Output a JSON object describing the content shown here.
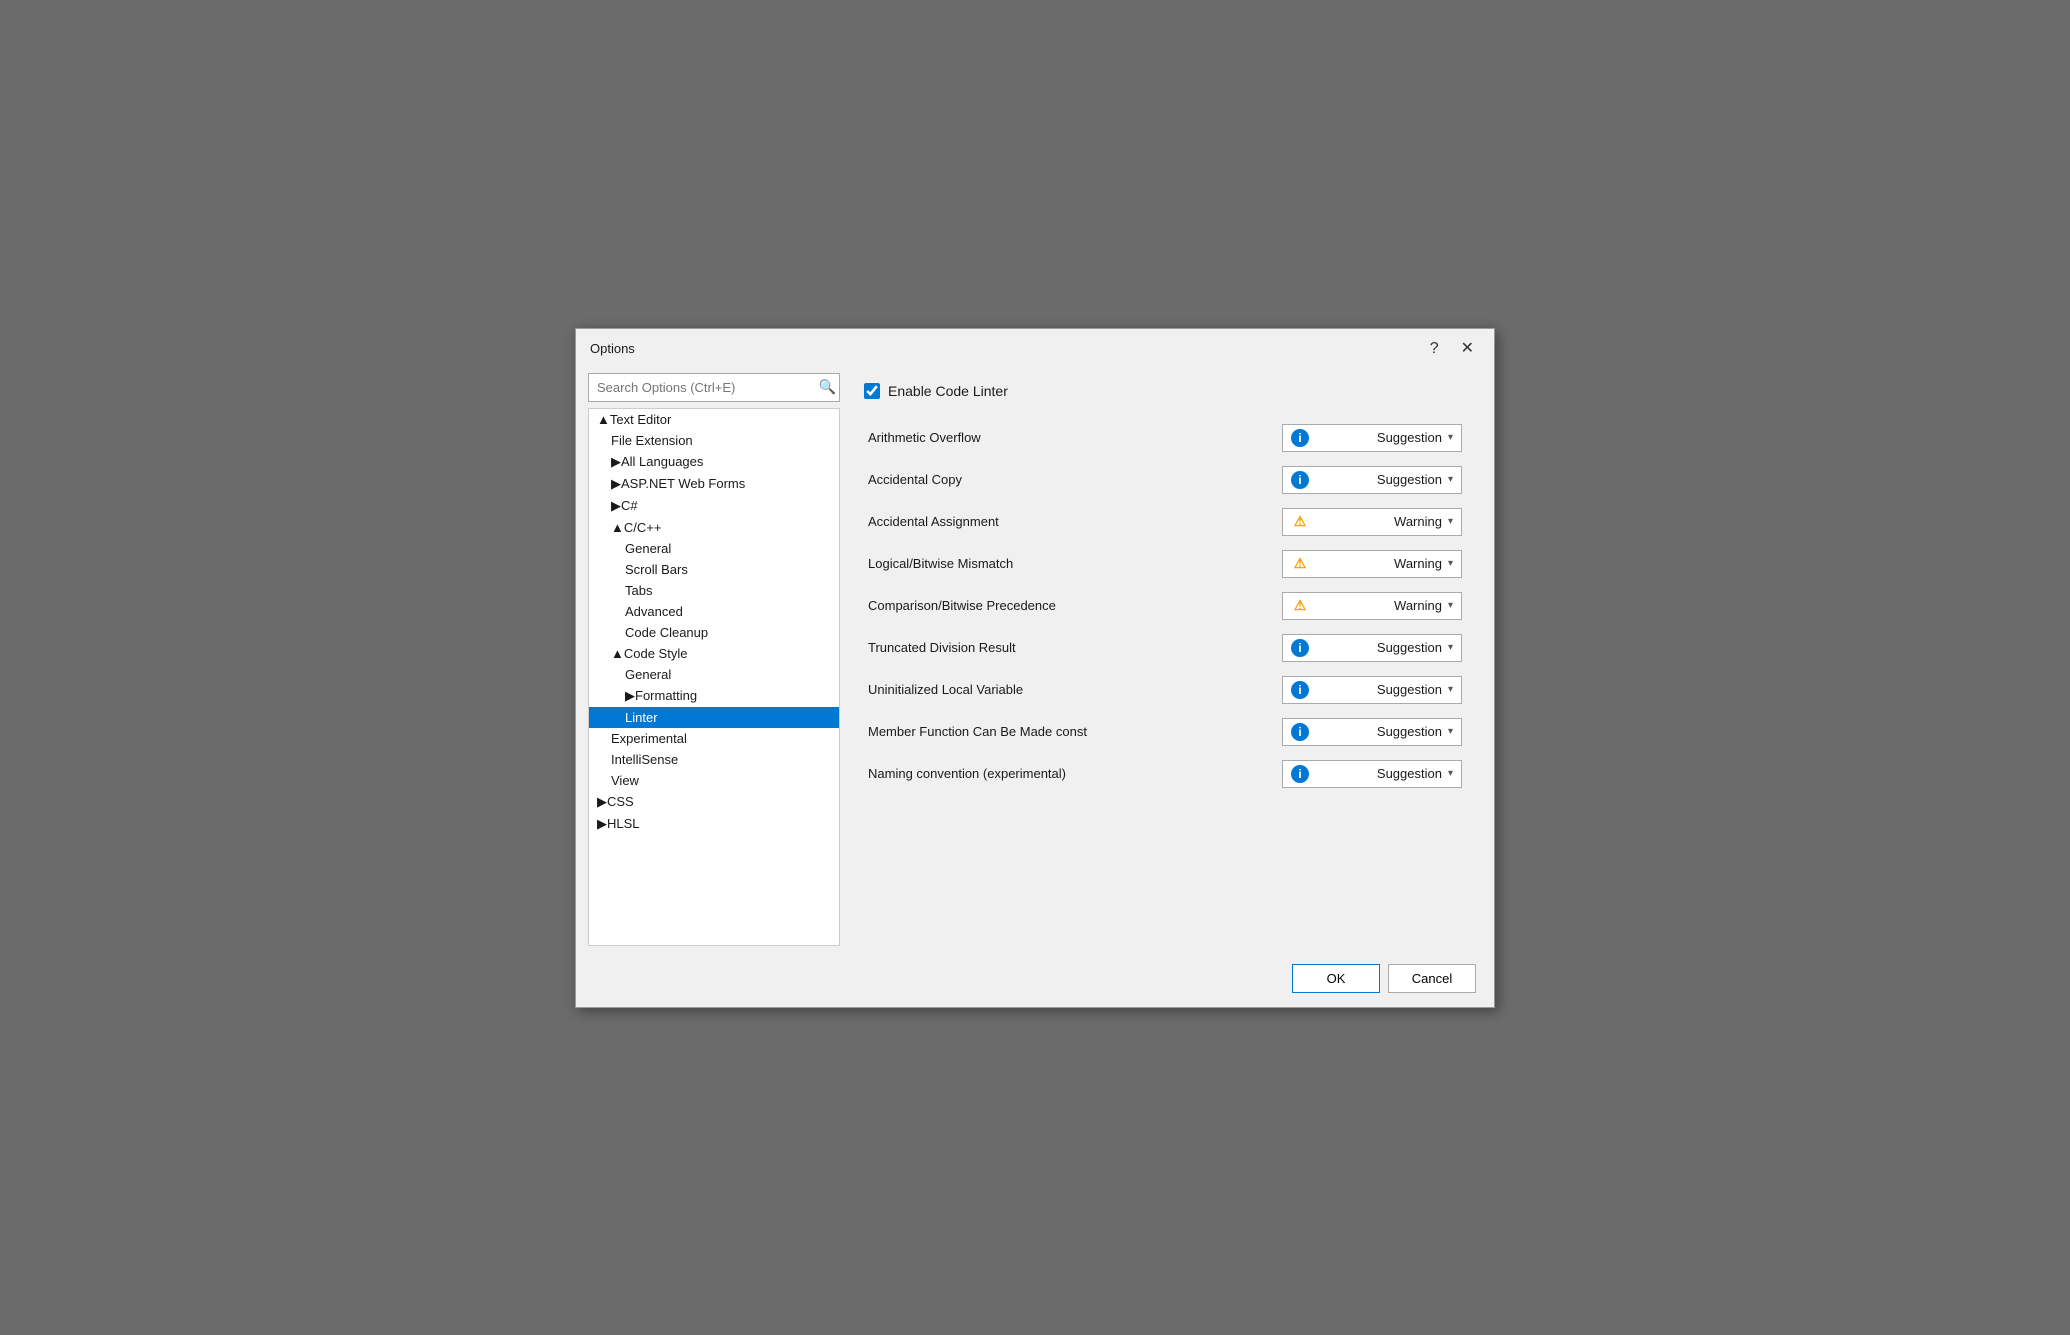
{
  "dialog": {
    "title": "Options",
    "help_btn": "?",
    "close_btn": "✕"
  },
  "search": {
    "placeholder": "Search Options (Ctrl+E)",
    "icon": "🔍"
  },
  "tree": {
    "items": [
      {
        "id": "text-editor",
        "label": "▲Text Editor",
        "level": 0,
        "selected": false
      },
      {
        "id": "file-extension",
        "label": "File Extension",
        "level": 1,
        "selected": false
      },
      {
        "id": "all-languages",
        "label": "▶All Languages",
        "level": 1,
        "selected": false
      },
      {
        "id": "aspnet",
        "label": "▶ASP.NET Web Forms",
        "level": 1,
        "selected": false
      },
      {
        "id": "csharp",
        "label": "▶C#",
        "level": 1,
        "selected": false
      },
      {
        "id": "cpp",
        "label": "▲C/C++",
        "level": 1,
        "selected": false
      },
      {
        "id": "cpp-general",
        "label": "General",
        "level": 2,
        "selected": false
      },
      {
        "id": "cpp-scrollbars",
        "label": "Scroll Bars",
        "level": 2,
        "selected": false
      },
      {
        "id": "cpp-tabs",
        "label": "Tabs",
        "level": 2,
        "selected": false
      },
      {
        "id": "cpp-advanced",
        "label": "Advanced",
        "level": 2,
        "selected": false
      },
      {
        "id": "cpp-codecleanup",
        "label": "Code Cleanup",
        "level": 2,
        "selected": false
      },
      {
        "id": "code-style",
        "label": "▲Code Style",
        "level": 1,
        "selected": false
      },
      {
        "id": "cs-general",
        "label": "General",
        "level": 2,
        "selected": false
      },
      {
        "id": "cs-formatting",
        "label": "▶Formatting",
        "level": 2,
        "selected": false
      },
      {
        "id": "cs-linter",
        "label": "Linter",
        "level": 2,
        "selected": true
      },
      {
        "id": "cs-experimental",
        "label": "Experimental",
        "level": 1,
        "selected": false
      },
      {
        "id": "cs-intellisense",
        "label": "IntelliSense",
        "level": 1,
        "selected": false
      },
      {
        "id": "cs-view",
        "label": "View",
        "level": 1,
        "selected": false
      },
      {
        "id": "css",
        "label": "▶CSS",
        "level": 0,
        "selected": false
      },
      {
        "id": "hlsl",
        "label": "▶HLSL",
        "level": 0,
        "selected": false
      }
    ]
  },
  "linter": {
    "enable_label": "Enable Code Linter",
    "enable_checked": true,
    "options": [
      {
        "name": "Arithmetic Overflow",
        "type": "info",
        "value": "Suggestion"
      },
      {
        "name": "Accidental Copy",
        "type": "info",
        "value": "Suggestion"
      },
      {
        "name": "Accidental Assignment",
        "type": "warning",
        "value": "Warning"
      },
      {
        "name": "Logical/Bitwise Mismatch",
        "type": "warning",
        "value": "Warning"
      },
      {
        "name": "Comparison/Bitwise Precedence",
        "type": "warning",
        "value": "Warning"
      },
      {
        "name": "Truncated Division Result",
        "type": "info",
        "value": "Suggestion"
      },
      {
        "name": "Uninitialized Local Variable",
        "type": "info",
        "value": "Suggestion"
      },
      {
        "name": "Member Function Can Be Made const",
        "type": "info",
        "value": "Suggestion"
      },
      {
        "name": "Naming convention (experimental)",
        "type": "info",
        "value": "Suggestion"
      }
    ]
  },
  "footer": {
    "ok_label": "OK",
    "cancel_label": "Cancel"
  }
}
